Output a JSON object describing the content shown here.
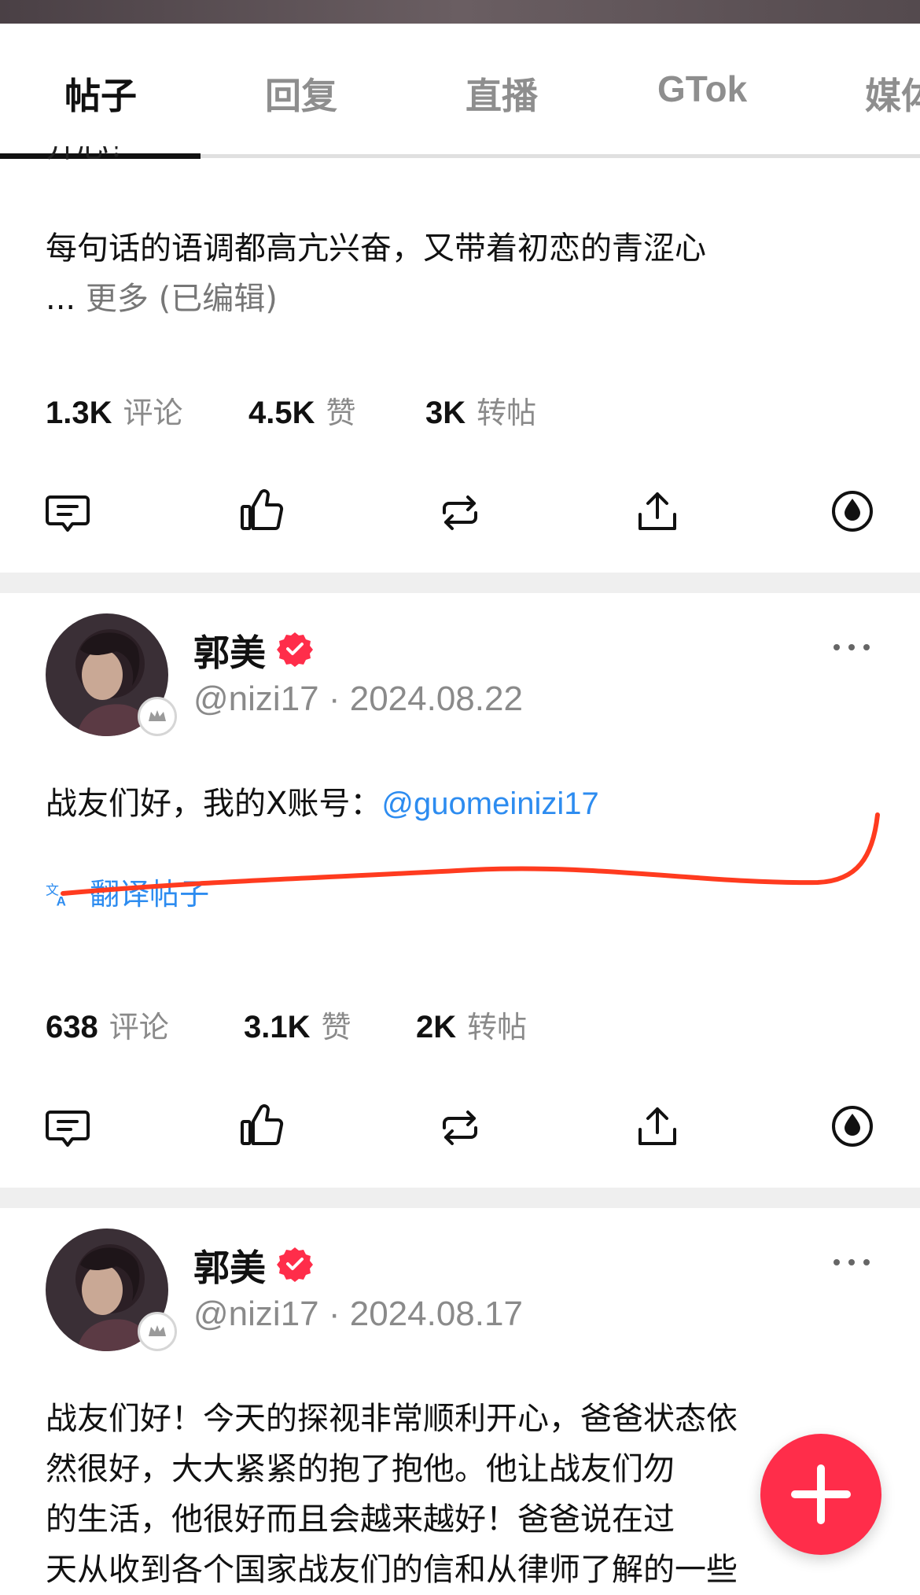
{
  "tabs": [
    "帖子",
    "回复",
    "直播",
    "GTok",
    "媒体"
  ],
  "post1": {
    "truncated_line": "开心！",
    "text": "每句话的语调都高亢兴奋，又带着初恋的青涩心",
    "ellipsis": "...",
    "more_label": "更多 (已编辑)",
    "comments_count": "1.3K",
    "comments_label": "评论",
    "likes_count": "4.5K",
    "likes_label": "赞",
    "reposts_count": "3K",
    "reposts_label": "转帖"
  },
  "post2": {
    "author": "郭美",
    "handle": "@nizi17 · 2024.08.22",
    "text": "战友们好，我的X账号：",
    "link": "@guomeinizi17",
    "translate_label": "翻译帖子",
    "comments_count": "638",
    "comments_label": "评论",
    "likes_count": "3.1K",
    "likes_label": "赞",
    "reposts_count": "2K",
    "reposts_label": "转帖"
  },
  "post3": {
    "author": "郭美",
    "handle": "@nizi17 · 2024.08.17",
    "lines": [
      "战友们好！今天的探视非常顺利开心，爸爸状态依",
      "然很好，大大紧紧的抱了抱他。他让战友们勿",
      "的生活，他很好而且会越来越好！爸爸说在过",
      "天从收到各个国家战友们的信和从律师了解的一些"
    ]
  },
  "colors": {
    "accent": "#ff2d4a",
    "link": "#2d8cf0",
    "annotation": "#ff3b1f"
  },
  "icons": [
    "comment-icon",
    "like-icon",
    "repost-icon",
    "share-icon",
    "tip-icon",
    "verified-icon",
    "more-icon",
    "translate-icon",
    "plus-icon"
  ]
}
